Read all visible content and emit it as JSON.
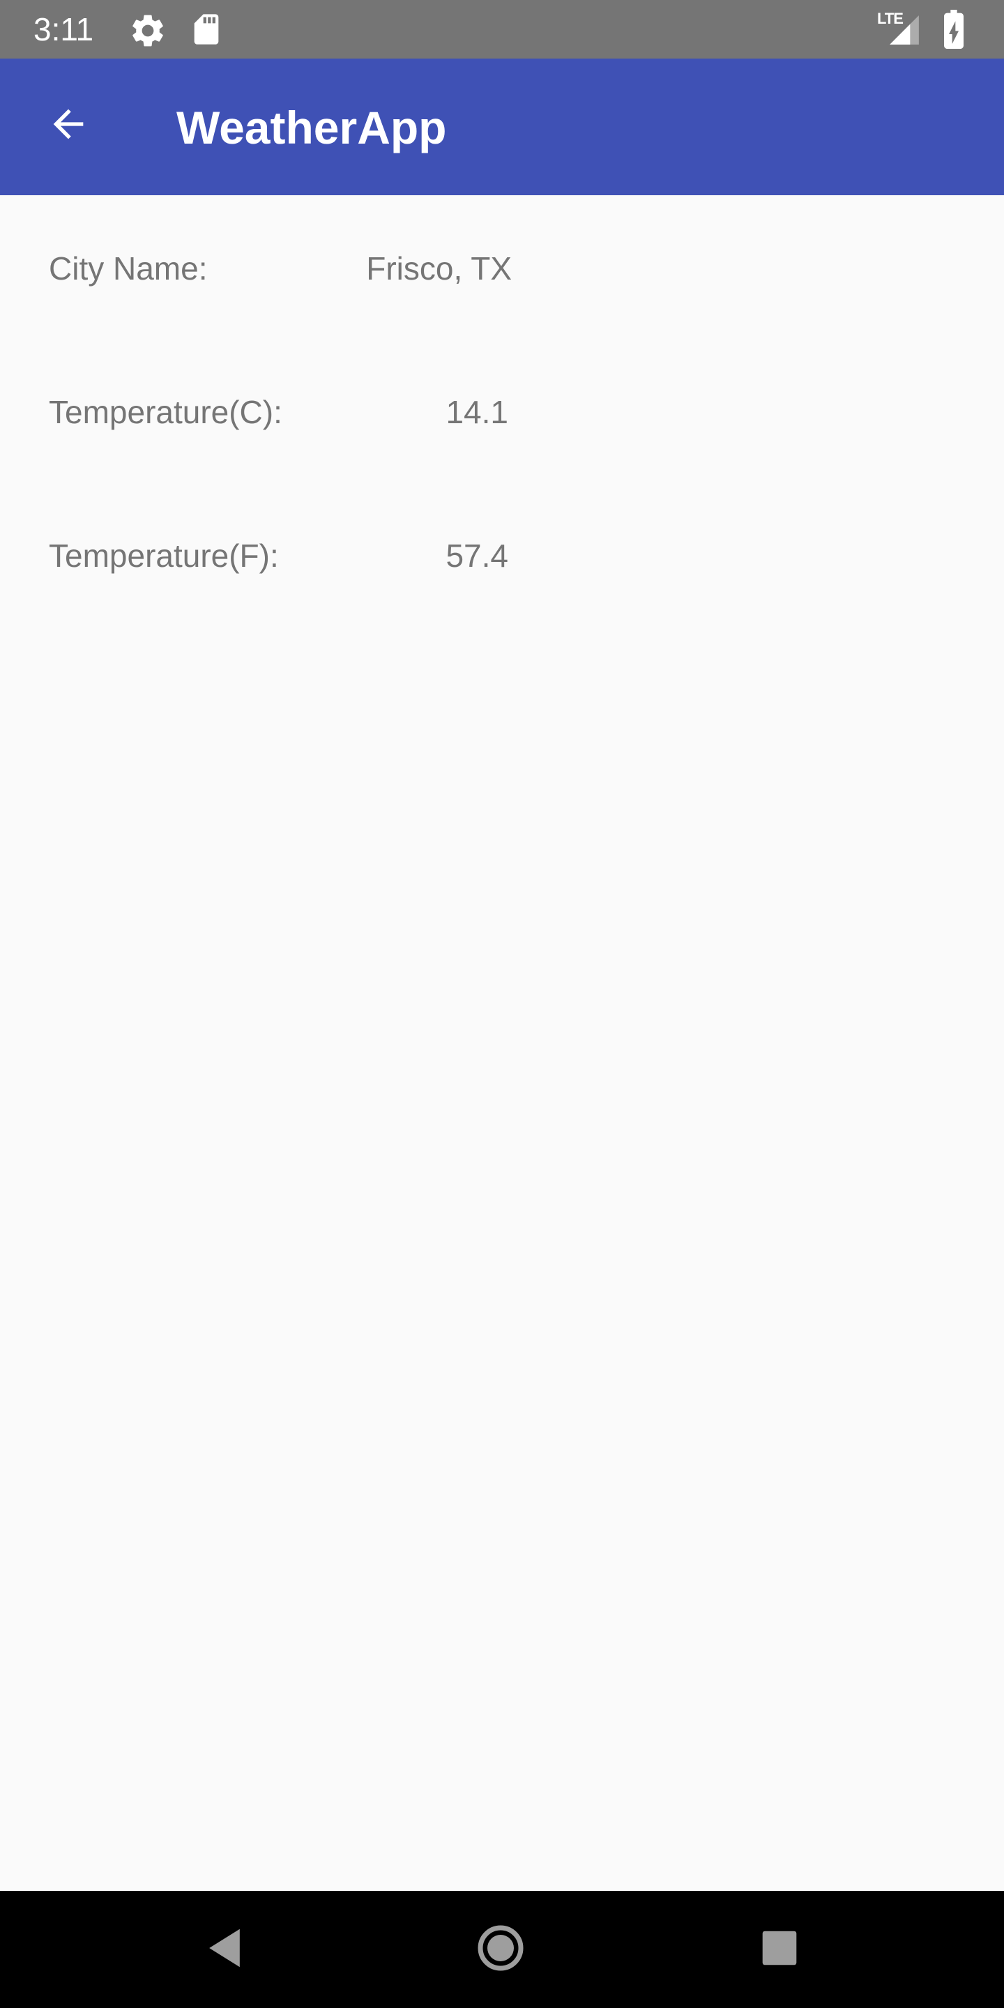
{
  "status_bar": {
    "time": "3:11",
    "network_label": "LTE",
    "icons": [
      "settings-icon",
      "sd-card-icon",
      "signal-icon",
      "battery-charging-icon"
    ]
  },
  "app_bar": {
    "title": "WeatherApp",
    "back_icon": "arrow-back-icon",
    "color": "#3f51b5"
  },
  "weather": {
    "city_label": "City Name:",
    "city_value": "Frisco, TX",
    "temp_c_label": "Temperature(C):",
    "temp_c_value": "14.1",
    "temp_f_label": "Temperature(F):",
    "temp_f_value": "57.4"
  },
  "nav_bar": {
    "icons": [
      "nav-back-icon",
      "nav-home-icon",
      "nav-recents-icon"
    ]
  }
}
